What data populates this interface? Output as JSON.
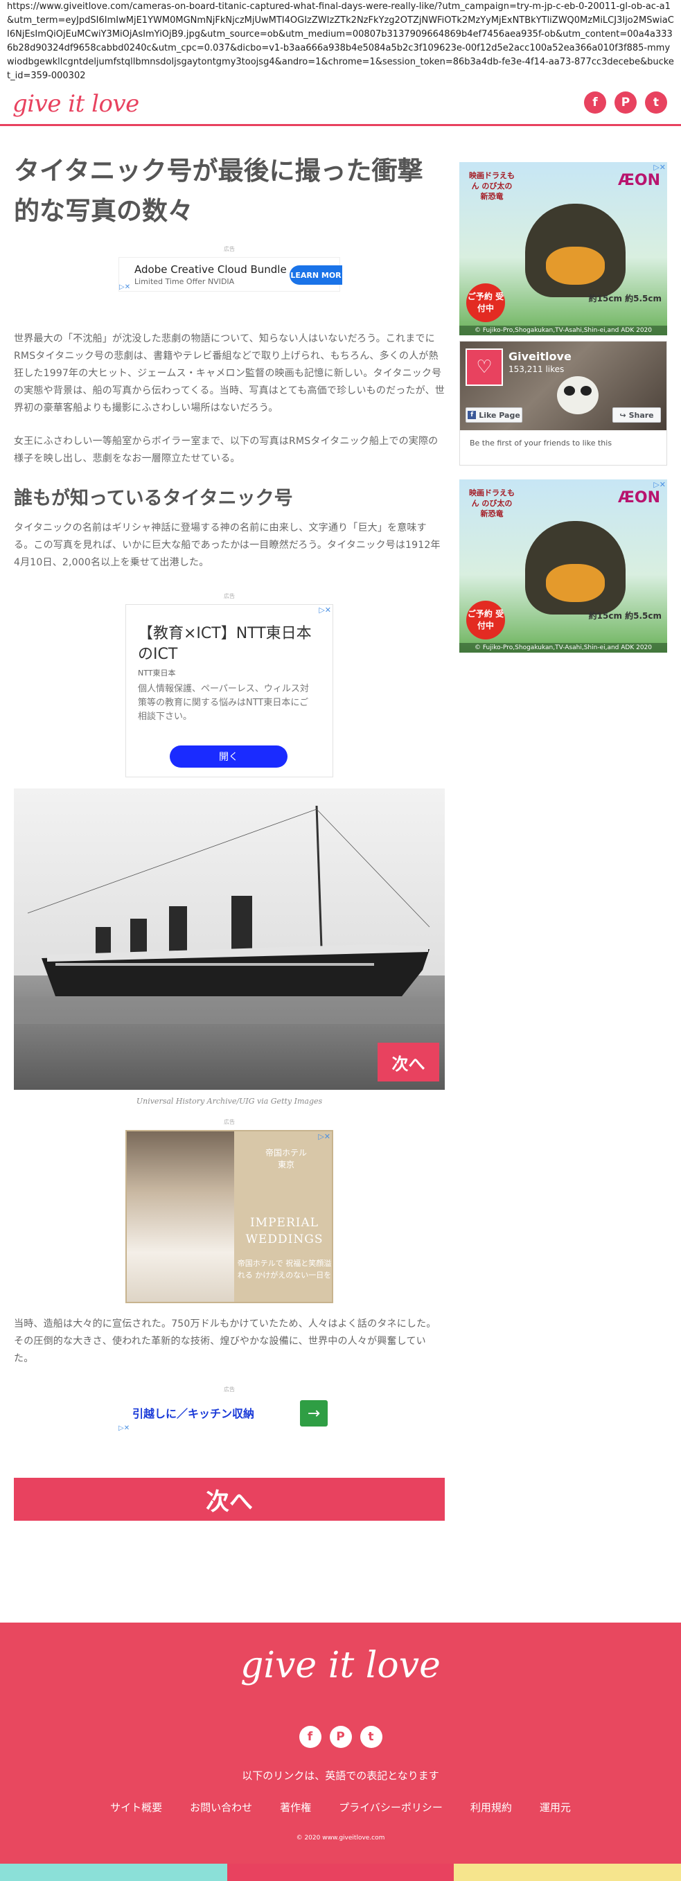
{
  "browser": {
    "url": "https://www.giveitlove.com/cameras-on-board-titanic-captured-what-final-days-were-really-like/?utm_campaign=try-m-jp-c-eb-0-20011-gl-ob-ac-a1&utm_term=eyJpdSI6ImIwMjE1YWM0MGNmNjFkNjczMjUwMTI4OGIzZWIzZTk2NzFkYzg2OTZjNWFiOTk2MzYyMjExNTBkYTliZWQ0MzMiLCJ3Ijo2MSwiaCI6NjEsImQiOjEuMCwiY3MiOjAsImYiOjB9.jpg&utm_source=ob&utm_medium=00807b3137909664869b4ef7456aea935f-ob&utm_content=00a4a3336b28d90324df9658cabbd0240c&utm_cpc=0.037&dicbo=v1-b3aa666a938b4e5084a5b2c3f109623e-00f12d5e2acc100a52ea366a010f3f885-mmywiodbgewkllcgntdeljumfstqllbmnsdoljsgaytontgmy3toojsg4&andro=1&chrome=1&session_token=86b3a4db-fe3e-4f14-aa73-877cc3decebe&bucket_id=359-000302"
  },
  "header": {
    "logo": "give it love",
    "social": [
      {
        "icon": "facebook-icon",
        "glyph": "f"
      },
      {
        "icon": "pinterest-icon",
        "glyph": "P"
      },
      {
        "icon": "twitter-icon",
        "glyph": "t"
      }
    ]
  },
  "article": {
    "title": "タイタニック号が最後に撮った衝撃的な写真の数々",
    "ad_label": "広告",
    "intro_p1": "世界最大の「不沈船」が沈没した悲劇の物語について、知らない人はいないだろう。これまでにRMSタイタニック号の悲劇は、書籍やテレビ番組などで取り上げられ、もちろん、多くの人が熱狂した1997年の大ヒット、ジェームス・キャメロン監督の映画も記憶に新しい。タイタニック号の実態や背景は、船の写真から伝わってくる。当時、写真はとても高価で珍しいものだったが、世界初の豪華客船よりも撮影にふさわしい場所はないだろう。",
    "intro_p2": "女王にふさわしい一等船室からボイラー室まで、以下の写真はRMSタイタニック船上での実際の様子を映し出し、悲劇をなお一層際立たせている。",
    "subheading": "誰もが知っているタイタニック号",
    "section_p1": "タイタニックの名前はギリシャ神話に登場する神の名前に由来し、文字通り「巨大」を意味する。この写真を見れば、いかに巨大な船であったかは一目瞭然だろう。タイタニック号は1912年4月10日、2,000名以上を乗せて出港した。",
    "photo_next": "次へ",
    "photo_credit": "Universal History Archive/UIG via Getty Images",
    "section_p2": "当時、造船は大々的に宣伝された。750万ドルもかけていたため、人々はよく話のタネにした。その圧倒的な大きさ、使われた革新的な技術、煌びやかな設備に、世界中の人々が興奮していた。",
    "next_button": "次へ"
  },
  "ads": {
    "adobe": {
      "title": "Adobe Creative Cloud Bundle",
      "subtitle": "Limited Time Offer NVIDIA",
      "cta": "LEARN MOR"
    },
    "ntt": {
      "headline": "【教育×ICT】NTT東日本のICT",
      "brand": "NTT東日本",
      "desc": "個人情報保護、ペーパーレス、ウィルス対策等の教育に関する悩みはNTT東日本にご相談下さい。",
      "cta": "開く"
    },
    "imperial": {
      "hotel": "帝国ホテル 東京",
      "english": "IMPERIAL WEDDINGS",
      "japanese": "帝国ホテルで 祝福と笑顔溢れる かけがえのない一日を"
    },
    "kitchen": {
      "text": "引越しに／キッチン収納",
      "arrow": "→"
    },
    "aeon": {
      "brand": "ÆON",
      "movie": "映画ドラえもん のび太の新恐竜",
      "badge": "ご予約 受付中",
      "price": "約15cm 約5.5cm",
      "copyright": "© Fujiko-Pro,Shogakukan,TV-Asahi,Shin-ei,and ADK 2020"
    }
  },
  "facebook_widget": {
    "page_name": "Giveitlove",
    "likes": "153,211 likes",
    "like_button": "Like Page",
    "share_button": "Share",
    "friends_text": "Be the first of your friends to like this"
  },
  "footer": {
    "logo": "give it love",
    "note": "以下のリンクは、英語での表記となります",
    "links": [
      "サイト概要",
      "お問い合わせ",
      "著作権",
      "プライバシーポリシー",
      "利用規約",
      "運用元"
    ],
    "copyright": "© 2020 www.giveitlove.com"
  },
  "colors": {
    "brand_pink": "#e8425f",
    "stripe": [
      "#8be0d8",
      "#e8425f",
      "#f6e58d"
    ]
  }
}
